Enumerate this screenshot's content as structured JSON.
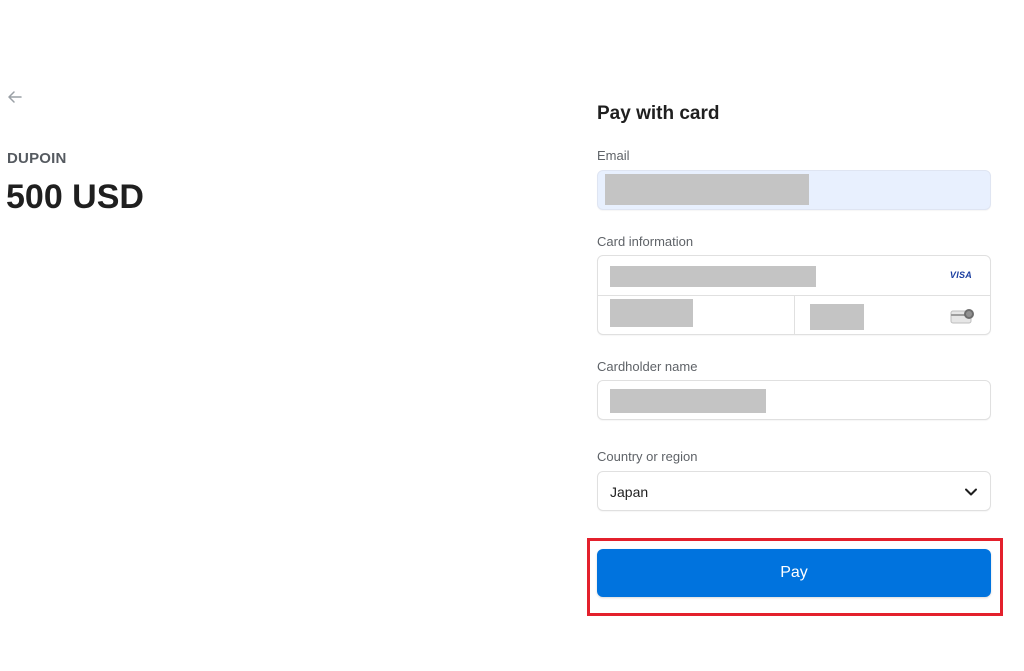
{
  "summary": {
    "merchant": "DUPOIN",
    "amount": "500 USD"
  },
  "form": {
    "title": "Pay with card",
    "email_label": "Email",
    "card_label": "Card information",
    "card_brand": "VISA",
    "cardholder_label": "Cardholder name",
    "country_label": "Country or region",
    "country_value": "Japan",
    "pay_label": "Pay"
  },
  "icons": {
    "back": "arrow-left-icon",
    "card_brand": "visa-icon",
    "cvc": "cvc-card-icon",
    "dropdown": "chevron-down-icon"
  },
  "colors": {
    "accent": "#0073de",
    "highlight": "#e3202c",
    "autofill_bg": "#e8f0fe",
    "redaction": "#c4c4c4"
  }
}
